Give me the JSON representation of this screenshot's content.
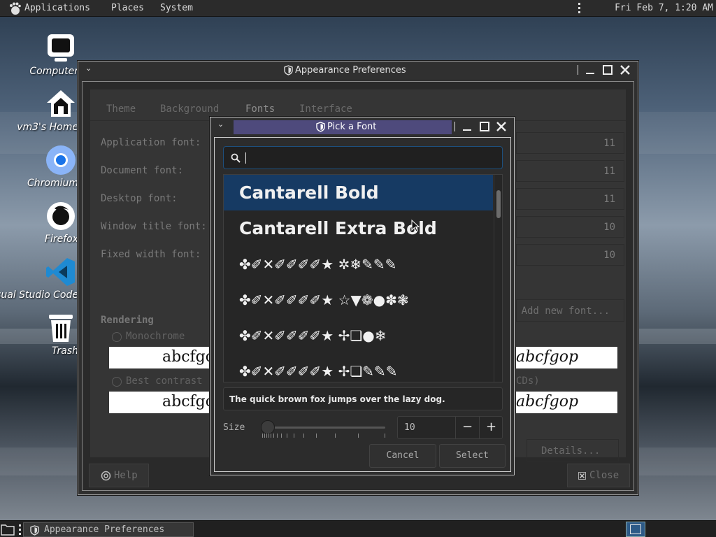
{
  "top_panel": {
    "menu": [
      "Applications",
      "Places",
      "System"
    ],
    "clock": "Fri Feb  7,  1:20 AM"
  },
  "desktop_icons": [
    {
      "label": "Computer",
      "icon": "computer-icon"
    },
    {
      "label": "vm3's Home",
      "icon": "home-icon"
    },
    {
      "label": "Chromium",
      "icon": "chromium-icon"
    },
    {
      "label": "Firefox",
      "icon": "firefox-icon"
    },
    {
      "label": "Visual Studio Code",
      "icon": "vscode-icon"
    },
    {
      "label": "Trash",
      "icon": "trash-icon"
    }
  ],
  "appearance_window": {
    "title": "Appearance Preferences",
    "tabs": [
      "Theme",
      "Background",
      "Fonts",
      "Interface"
    ],
    "active_tab": "Fonts",
    "font_rows": [
      {
        "label": "Application font:",
        "size": "11"
      },
      {
        "label": "Document font:",
        "size": "11"
      },
      {
        "label": "Desktop font:",
        "size": "11"
      },
      {
        "label": "Window title font:",
        "size": "10"
      },
      {
        "label": "Fixed width font:",
        "size": "10"
      }
    ],
    "add_font_label": "Add new font...",
    "rendering_heading": "Rendering",
    "rendering_options": [
      {
        "label": "Monochrome",
        "sample": "abcfgop"
      },
      {
        "label": "Best contrast",
        "sample": "abcfgop"
      }
    ],
    "right_samples": [
      "abcfgop",
      "abcfgop"
    ],
    "right_option_hint": "CDs)",
    "details_label": "Details...",
    "help_label": "Help",
    "close_label": "Close"
  },
  "font_dialog": {
    "title": "Pick a Font",
    "search": {
      "value": "",
      "placeholder": ""
    },
    "fonts": [
      {
        "name": "Cantarell Bold",
        "selected": true
      },
      {
        "name": "Cantarell Extra Bold",
        "selected": false
      },
      {
        "name": "✤✐✕✐✐✐✐★ ✲❄✎✎✎",
        "selected": false
      },
      {
        "name": "✤✐✕✐✐✐✐★ ☆▼❁●✽❃",
        "selected": false
      },
      {
        "name": "✤✐✕✐✐✐✐★ ✢❏●❄",
        "selected": false
      },
      {
        "name": "✤✐✕✐✐✐✐★ ✢❏✎✎✎",
        "selected": false
      }
    ],
    "preview_text": "The quick brown fox jumps over the lazy dog.",
    "size_label": "Size",
    "size_value": "10",
    "cancel_label": "Cancel",
    "select_label": "Select"
  },
  "taskbar": {
    "task_label": "Appearance Preferences"
  },
  "colors": {
    "selection": "#163a63",
    "dialog_title_highlight": "#4e4a7c",
    "search_border": "#1d4f7d"
  }
}
